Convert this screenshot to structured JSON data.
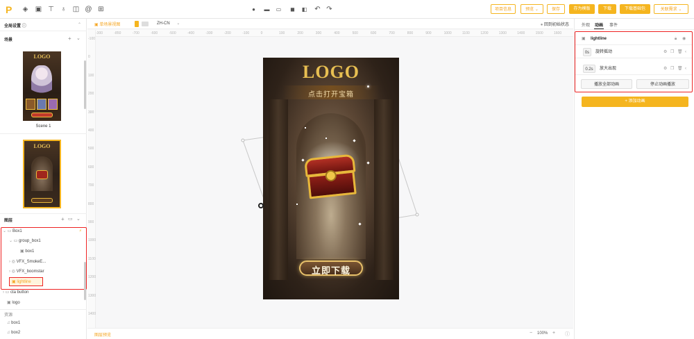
{
  "header": {
    "logo": "P",
    "lang": "ZH-CN",
    "buttons": {
      "project_info": "项目信息",
      "preview": "预览",
      "save": "保存",
      "save_template": "存为模版",
      "download": "下载",
      "download_base": "下载基础包",
      "related": "关联需求"
    }
  },
  "subbar": {
    "single_scene_mode": "单场景视图",
    "zh_cn": "ZH-CN",
    "return_initial": "回到初始状态"
  },
  "left": {
    "global_settings": "全局设置",
    "scenes_title": "场景",
    "scene1_label": "Scene 1",
    "layers_title": "图层",
    "layers": [
      {
        "label": "Box1"
      },
      {
        "label": "group_box1"
      },
      {
        "label": "box1"
      },
      {
        "label": "VFX_SmokeE..."
      },
      {
        "label": "VFX_boomstar"
      },
      {
        "label": "lightline"
      },
      {
        "label": "cta button"
      },
      {
        "label": "logo"
      }
    ],
    "assets_title": "资源",
    "assets": [
      {
        "label": "box1"
      },
      {
        "label": "box2"
      }
    ]
  },
  "canvas": {
    "ruler_top": [
      "-300",
      "-850",
      "-700",
      "-600",
      "-500",
      "-400",
      "-300",
      "-200",
      "-100",
      "0",
      "100",
      "200",
      "300",
      "400",
      "500",
      "600",
      "700",
      "800",
      "900",
      "1000",
      "1100",
      "1200",
      "1300",
      "1400",
      "1500",
      "1600"
    ],
    "ruler_left": [
      "-100",
      "0",
      "100",
      "200",
      "300",
      "400",
      "500",
      "600",
      "700",
      "800",
      "900",
      "1000",
      "1100",
      "1200",
      "1300",
      "1400"
    ],
    "ad": {
      "logo": "LOGO",
      "subtitle": "点击打开宝箱",
      "cta": "立即下载"
    },
    "bottom_left": "图层预览",
    "zoom": "100%"
  },
  "right": {
    "tabs": [
      "外观",
      "动画",
      "事件"
    ],
    "active_tab": "动画",
    "layer_name": "lightline",
    "animations": [
      {
        "delay": "0s",
        "name": "旋转摇动"
      },
      {
        "delay": "0.2s",
        "name": "放大出现"
      }
    ],
    "play_all": "播放全部动画",
    "stop_all": "停止动画播放",
    "add_anim": "+ 添加动画"
  },
  "colors": {
    "accent": "#f5b51f",
    "highlight": "#e22222"
  }
}
